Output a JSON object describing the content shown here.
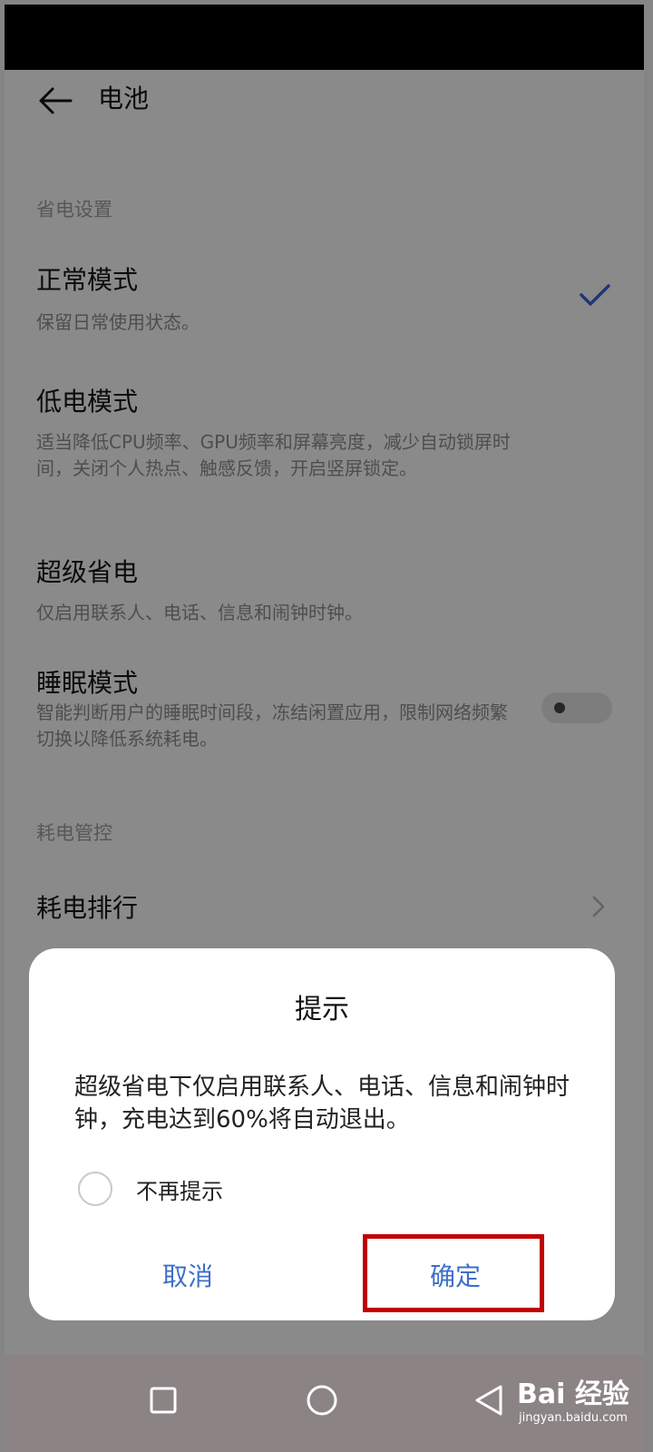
{
  "page": {
    "title": "电池"
  },
  "sections": {
    "power_saving_header": "省电设置",
    "power_control_header": "耗电管控"
  },
  "items": {
    "normal_mode": {
      "title": "正常模式",
      "desc": "保留日常使用状态。",
      "selected": true
    },
    "low_power_mode": {
      "title": "低电模式",
      "desc": "适当降低CPU频率、GPU频率和屏幕亮度，减少自动锁屏时间，关闭个人热点、触感反馈，开启竖屏锁定。"
    },
    "super_power_saving": {
      "title": "超级省电",
      "desc": "仅启用联系人、电话、信息和闹钟时钟。"
    },
    "sleep_mode": {
      "title": "睡眠模式",
      "desc": "智能判断用户的睡眠时间段，冻结闲置应用，限制网络频繁切换以降低系统耗电。",
      "toggle_on": false
    },
    "power_ranking": {
      "title": "耗电排行"
    }
  },
  "dialog": {
    "title": "提示",
    "message": "超级省电下仅启用联系人、电话、信息和闹钟时钟，充电达到60%将自动退出。",
    "dont_remind_label": "不再提示",
    "dont_remind_checked": false,
    "cancel_label": "取消",
    "confirm_label": "确定"
  },
  "watermark": {
    "brand": "Bai 经验",
    "site": "jingyan.baidu.com"
  },
  "colors": {
    "accent": "#3d6fc9",
    "highlight": "#c00000"
  }
}
